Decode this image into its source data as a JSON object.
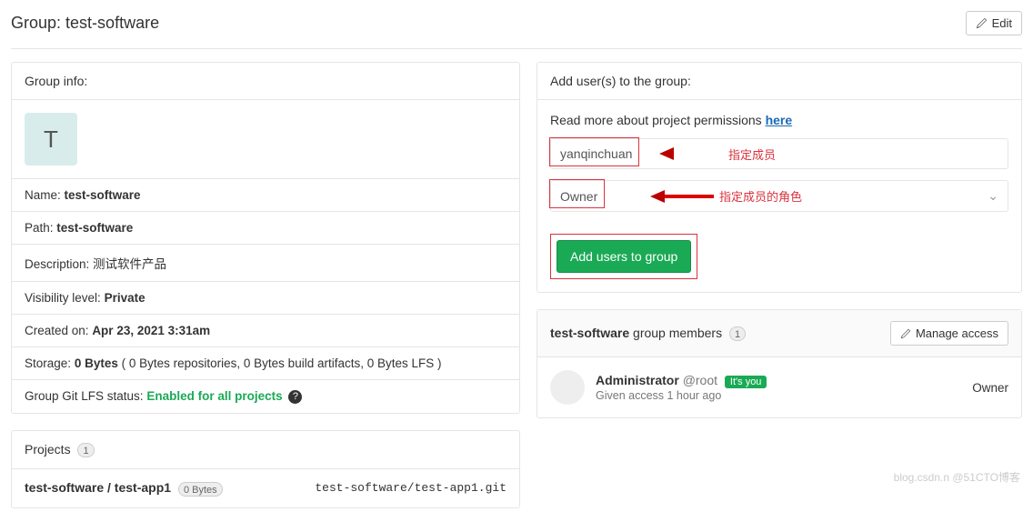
{
  "header": {
    "title_prefix": "Group:",
    "group_name": "test-software",
    "edit_label": "Edit"
  },
  "group_info": {
    "title": "Group info:",
    "avatar_letter": "T",
    "rows": {
      "name_label": "Name:",
      "name_value": "test-software",
      "path_label": "Path:",
      "path_value": "test-software",
      "desc_label": "Description:",
      "desc_value": "测试软件产品",
      "vis_label": "Visibility level:",
      "vis_value": "Private",
      "created_label": "Created on:",
      "created_value": "Apr 23, 2021 3:31am",
      "storage_label": "Storage:",
      "storage_value": "0 Bytes",
      "storage_detail": "( 0 Bytes repositories, 0 Bytes build artifacts, 0 Bytes LFS )",
      "lfs_label": "Group Git LFS status:",
      "lfs_value": "Enabled for all projects"
    }
  },
  "projects": {
    "title": "Projects",
    "count": "1",
    "item": {
      "breadcrumb": "test-software / test-app1",
      "size": "0 Bytes",
      "path": "test-software/test-app1.git"
    }
  },
  "add_users": {
    "title": "Add user(s) to the group:",
    "perm_text": "Read more about project permissions",
    "perm_link": "here",
    "user_value": "yanqinchuan",
    "ann_user": "指定成员",
    "role_value": "Owner",
    "ann_role": "指定成员的角色",
    "submit": "Add users to group"
  },
  "members": {
    "title_bold": "test-software",
    "title_rest": "group members",
    "count": "1",
    "manage": "Manage access",
    "user_name": "Administrator",
    "user_handle": "@root",
    "its_you": "It's you",
    "access_text": "Given access 1 hour ago",
    "role": "Owner"
  },
  "watermark": "blog.csdn.n @51CTO博客"
}
